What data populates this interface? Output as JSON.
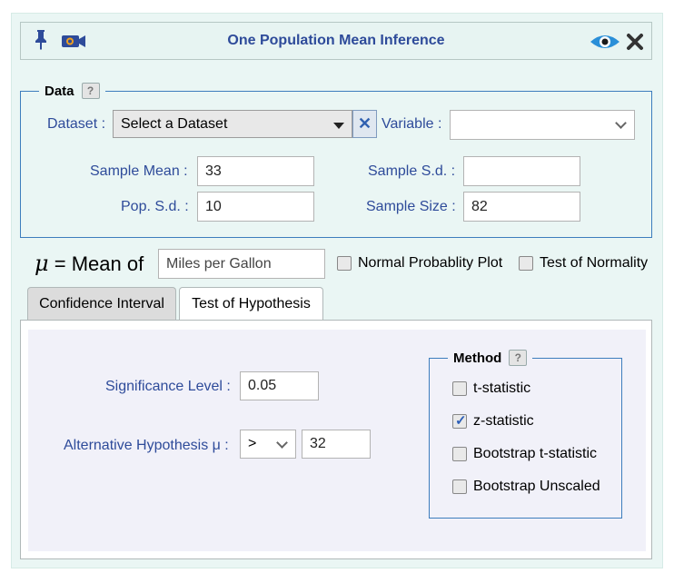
{
  "window": {
    "title": "One Population Mean Inference",
    "icons": [
      "pin-icon",
      "camera-icon",
      "eye-icon",
      "close-icon"
    ]
  },
  "data_section": {
    "legend": "Data",
    "help": "?",
    "dataset_label": "Dataset :",
    "dataset_value": "Select a Dataset",
    "variable_label": "Variable :",
    "variable_value": "",
    "sample_mean_label": "Sample Mean :",
    "sample_mean_value": "33",
    "sample_sd_label": "Sample S.d. :",
    "sample_sd_value": "",
    "pop_sd_label": "Pop. S.d. :",
    "pop_sd_value": "10",
    "sample_size_label": "Sample Size :",
    "sample_size_value": "82"
  },
  "mean_of": {
    "symbol": "μ",
    "label": "= Mean of",
    "value": "Miles per Gallon",
    "normal_plot_label": "Normal Probablity Plot",
    "normality_test_label": "Test of Normality"
  },
  "tabs": [
    {
      "label": "Confidence Interval",
      "active": false
    },
    {
      "label": "Test of Hypothesis",
      "active": true
    }
  ],
  "hypothesis": {
    "significance_label": "Significance Level :",
    "significance_value": "0.05",
    "alternative_label": "Alternative Hypothesis μ :",
    "alternative_operator": ">",
    "alternative_value": "32"
  },
  "method": {
    "legend": "Method",
    "help": "?",
    "options": [
      {
        "label": "t-statistic",
        "checked": false
      },
      {
        "label": "z-statistic",
        "checked": true
      },
      {
        "label": "Bootstrap t-statistic",
        "checked": false
      },
      {
        "label": "Bootstrap Unscaled",
        "checked": false
      }
    ]
  },
  "colors": {
    "accent": "#2e4b9a",
    "border_blue": "#3d7dbd",
    "panel_bg": "#eaf6f4"
  }
}
